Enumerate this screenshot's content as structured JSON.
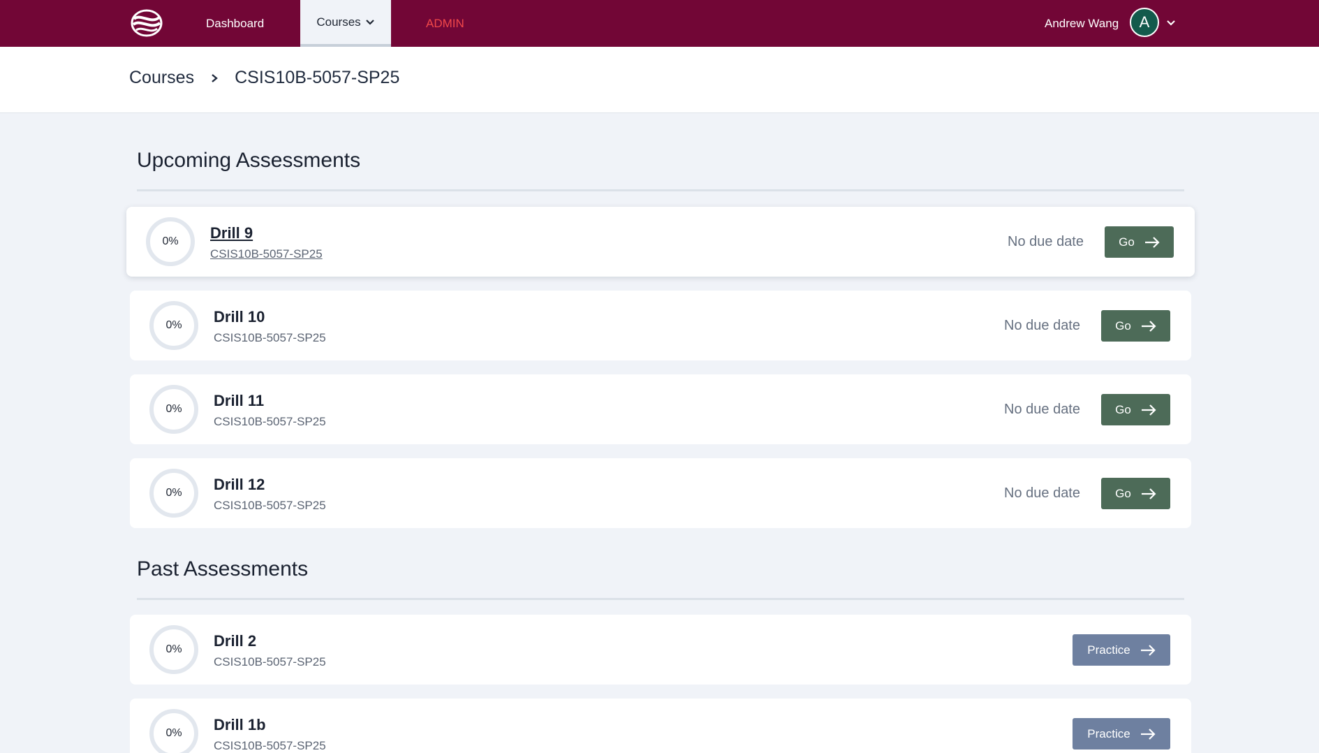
{
  "nav": {
    "dashboard": "Dashboard",
    "courses": "Courses",
    "admin": "ADMIN",
    "user_name": "Andrew Wang",
    "avatar_initial": "A"
  },
  "breadcrumb": {
    "root": "Courses",
    "current": "CSIS10B-5057-SP25"
  },
  "upcoming": {
    "title": "Upcoming Assessments",
    "items": [
      {
        "progress": "0%",
        "title": "Drill 9",
        "course": "CSIS10B-5057-SP25",
        "due": "No due date",
        "action": "Go"
      },
      {
        "progress": "0%",
        "title": "Drill 10",
        "course": "CSIS10B-5057-SP25",
        "due": "No due date",
        "action": "Go"
      },
      {
        "progress": "0%",
        "title": "Drill 11",
        "course": "CSIS10B-5057-SP25",
        "due": "No due date",
        "action": "Go"
      },
      {
        "progress": "0%",
        "title": "Drill 12",
        "course": "CSIS10B-5057-SP25",
        "due": "No due date",
        "action": "Go"
      }
    ]
  },
  "past": {
    "title": "Past Assessments",
    "items": [
      {
        "progress": "0%",
        "title": "Drill 2",
        "course": "CSIS10B-5057-SP25",
        "action": "Practice"
      },
      {
        "progress": "0%",
        "title": "Drill 1b",
        "course": "CSIS10B-5057-SP25",
        "action": "Practice"
      }
    ]
  },
  "colors": {
    "nav_bg": "#720636",
    "admin_red": "#f0484a",
    "go_green": "#4d6b58",
    "practice_blue": "#6e80a0",
    "avatar_green": "#135a4c"
  }
}
